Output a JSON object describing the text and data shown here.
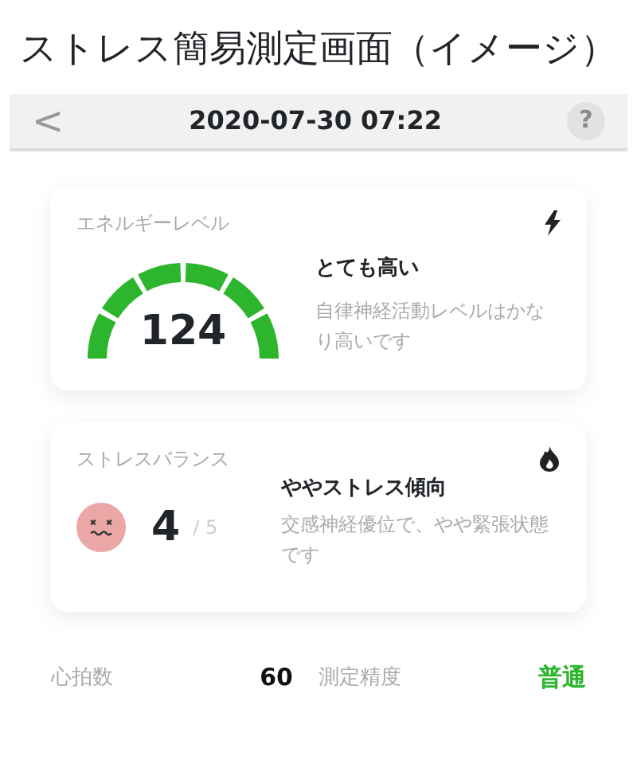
{
  "caption": "ストレス簡易測定画面（イメージ）",
  "header": {
    "back": "<",
    "title": "2020-07-30 07:22",
    "help": "?"
  },
  "energy": {
    "title": "エネルギーレベル",
    "value": "124",
    "status": "とても高い",
    "description": "自律神経活動レベルはかなり高いです"
  },
  "stress": {
    "title": "ストレスバランス",
    "value": "4",
    "max": "/ 5",
    "status": "ややストレス傾向",
    "description": "交感神経優位で、やや緊張状態です"
  },
  "footer": [
    {
      "label": "心拍数",
      "value": "60",
      "kind": "number"
    },
    {
      "label": "測定精度",
      "value": "普通",
      "kind": "grade"
    }
  ]
}
